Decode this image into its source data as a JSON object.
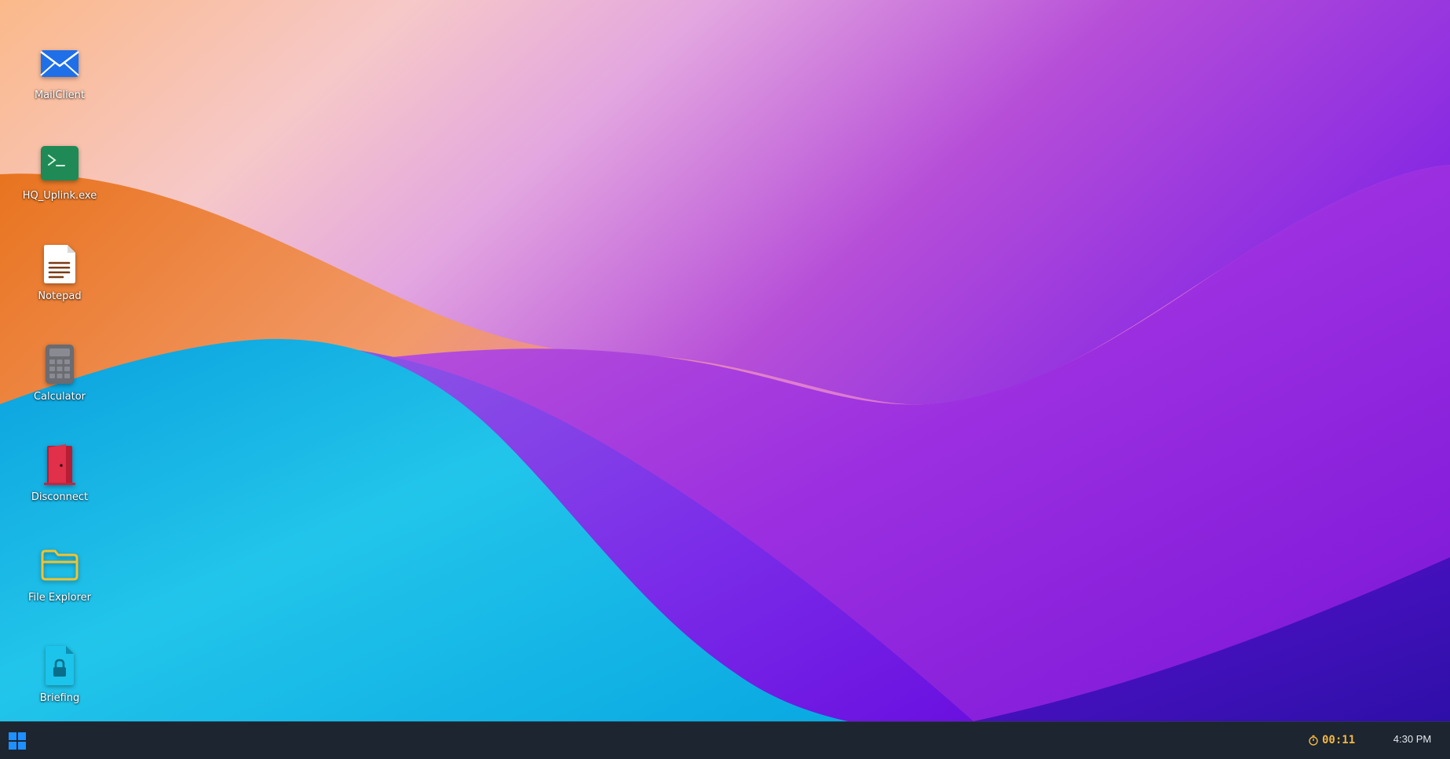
{
  "desktop": {
    "icons": [
      {
        "label": "MailClient",
        "icon": "mail-icon",
        "color": "#1f6fe8"
      },
      {
        "label": "HQ_Uplink.exe",
        "icon": "terminal-icon",
        "color": "#1f8a55"
      },
      {
        "label": "Notepad",
        "icon": "notepad-icon",
        "color": "#ffffff"
      },
      {
        "label": "Calculator",
        "icon": "calculator-icon",
        "color": "#6b6b72"
      },
      {
        "label": "Disconnect",
        "icon": "door-icon",
        "color": "#e0304a"
      },
      {
        "label": "File Explorer",
        "icon": "folder-icon",
        "color": "#f2c230"
      },
      {
        "label": "Briefing",
        "icon": "locked-file-icon",
        "color": "#1cc3ea"
      }
    ]
  },
  "taskbar": {
    "start_icon": "windows-logo-icon",
    "start_color": "#1e90ff",
    "timer": {
      "icon": "stopwatch-icon",
      "value": "00:11",
      "color": "#f4b740"
    },
    "clock": "4:30 PM"
  }
}
